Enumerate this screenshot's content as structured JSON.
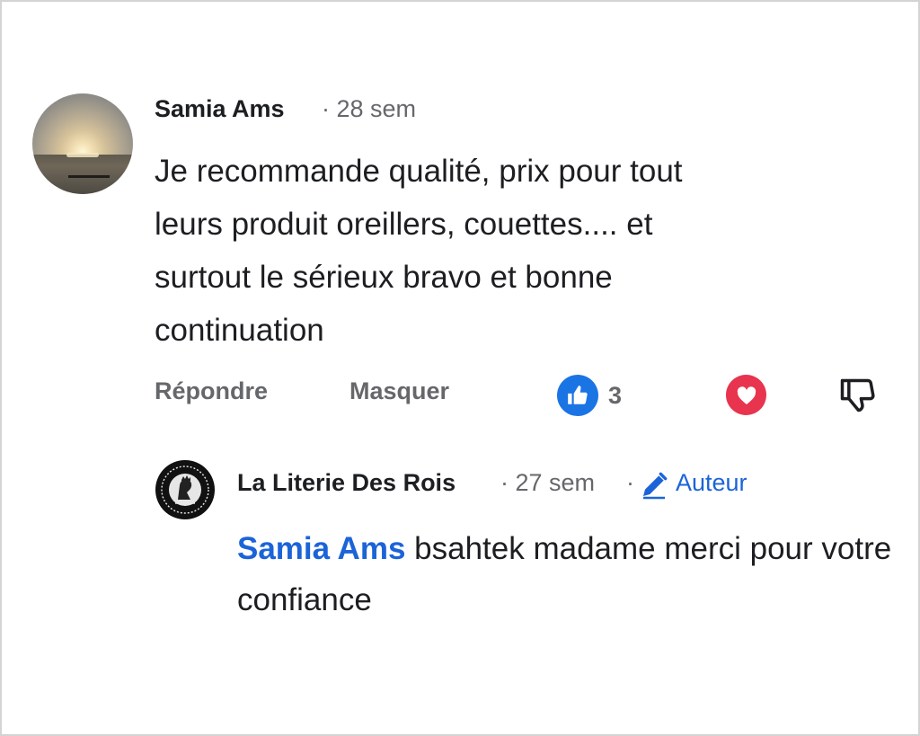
{
  "comment": {
    "author": "Samia Ams",
    "time": "· 28 sem",
    "text": "Je recommande qualité,  prix pour tout\nleurs produit oreillers,  couettes.... et\nsurtout le sérieux bravo et bonne\ncontinuation",
    "actions": {
      "reply_label": "Répondre",
      "hide_label": "Masquer"
    },
    "reactions": {
      "like_count": "3",
      "like_icon": "thumbs-up-icon",
      "love_icon": "heart-icon",
      "dislike_icon": "thumbs-down-icon"
    }
  },
  "reply": {
    "author": "La Literie Des Rois",
    "time": "· 27 sem",
    "separator": "·",
    "badge_label": "Auteur",
    "badge_icon": "pencil-icon",
    "mention": "Samia Ams",
    "text": " bsahtek madame merci pour votre confiance"
  },
  "colors": {
    "accent_blue": "#1b64d8",
    "like_blue": "#1b74e4",
    "love_red": "#e8344e",
    "muted_text": "#65676b"
  }
}
